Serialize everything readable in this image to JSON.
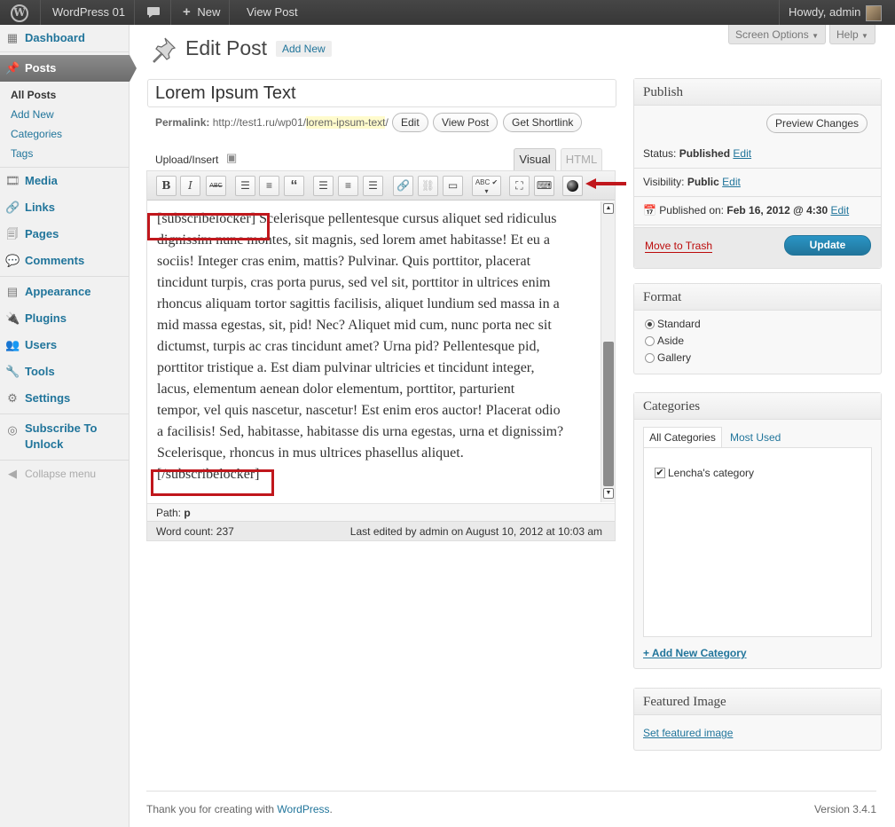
{
  "adminbar": {
    "site_name": "WordPress 01",
    "comments_icon": "speech-bubble-icon",
    "new_label": "New",
    "view_post_label": "View Post",
    "howdy": "Howdy, admin"
  },
  "sidebar": {
    "dashboard": "Dashboard",
    "posts": "Posts",
    "submenu": [
      "All Posts",
      "Add New",
      "Categories",
      "Tags"
    ],
    "media": "Media",
    "links": "Links",
    "pages": "Pages",
    "comments": "Comments",
    "appearance": "Appearance",
    "plugins": "Plugins",
    "users": "Users",
    "tools": "Tools",
    "settings": "Settings",
    "subscribe_line1": "Subscribe To",
    "subscribe_line2": "Unlock",
    "collapse": "Collapse menu"
  },
  "header": {
    "screen_options": "Screen Options",
    "help": "Help",
    "title": "Edit Post",
    "add_new": "Add New"
  },
  "post": {
    "title": "Lorem Ipsum Text",
    "permalink_label": "Permalink:",
    "permalink_base": "http://test1.ru/wp01/",
    "permalink_slug": "lorem-ipsum-text",
    "permalink_end": "/",
    "edit_btn": "Edit",
    "view_post_btn": "View Post",
    "shortlink_btn": "Get Shortlink"
  },
  "editor": {
    "upload_insert": "Upload/Insert",
    "tab_visual": "Visual",
    "tab_html": "HTML",
    "toolbar": {
      "bold": "B",
      "italic": "I",
      "strike": "ABC",
      "quote": "“"
    },
    "lines": [
      "[subscribelocker] Scelerisque pellentesque cursus aliquet sed ridiculus",
      "dignissim nunc montes, sit magnis, sed lorem amet habitasse! Et eu a",
      "sociis! Integer cras enim, mattis? Pulvinar. Quis porttitor, placerat",
      "tincidunt turpis, cras porta purus, sed vel sit, porttitor in ultrices enim",
      "rhoncus aliquam tortor sagittis facilisis, aliquet lundium sed massa in a",
      "mid massa egestas, sit, pid! Nec? Aliquet mid cum, nunc porta nec sit",
      "dictumst, turpis ac cras tincidunt amet? Urna pid? Pellentesque pid,",
      "porttitor tristique a. Est diam pulvinar ultricies et tincidunt integer,",
      "lacus, elementum aenean dolor elementum, porttitor, parturient",
      "tempor, vel quis nascetur, nascetur! Est enim eros auctor! Placerat odio",
      "a facilisis! Sed, habitasse, habitasse dis urna egestas, urna et dignissim?",
      "Scelerisque, rhoncus in mus ultrices phasellus aliquet.",
      "[/subscribelocker]"
    ],
    "path_label": "Path:",
    "path_value": "p",
    "word_count": "Word count: 237",
    "last_edited": "Last edited by admin on August 10, 2012 at 10:03 am"
  },
  "publish": {
    "title": "Publish",
    "preview": "Preview Changes",
    "status_label": "Status:",
    "status_value": "Published",
    "visibility_label": "Visibility:",
    "visibility_value": "Public",
    "published_label": "Published on:",
    "published_value": "Feb 16, 2012 @ 4:30",
    "edit": "Edit",
    "trash": "Move to Trash",
    "update": "Update"
  },
  "format": {
    "title": "Format",
    "options": [
      "Standard",
      "Aside",
      "Gallery"
    ],
    "selected": "Standard"
  },
  "categories": {
    "title": "Categories",
    "tab_all": "All Categories",
    "tab_used": "Most Used",
    "items": [
      {
        "label": "Lencha's category",
        "checked": true
      }
    ],
    "add_new": "+ Add New Category"
  },
  "featured": {
    "title": "Featured Image",
    "link": "Set featured image"
  },
  "footer": {
    "thanks": "Thank you for creating with ",
    "wp_link": "WordPress",
    "dot": ".",
    "version": "Version 3.4.1"
  },
  "colors": {
    "link": "#21759b",
    "highlight_box": "#c0171c",
    "update_button": "#21759b",
    "trash": "#bc0b0b"
  }
}
